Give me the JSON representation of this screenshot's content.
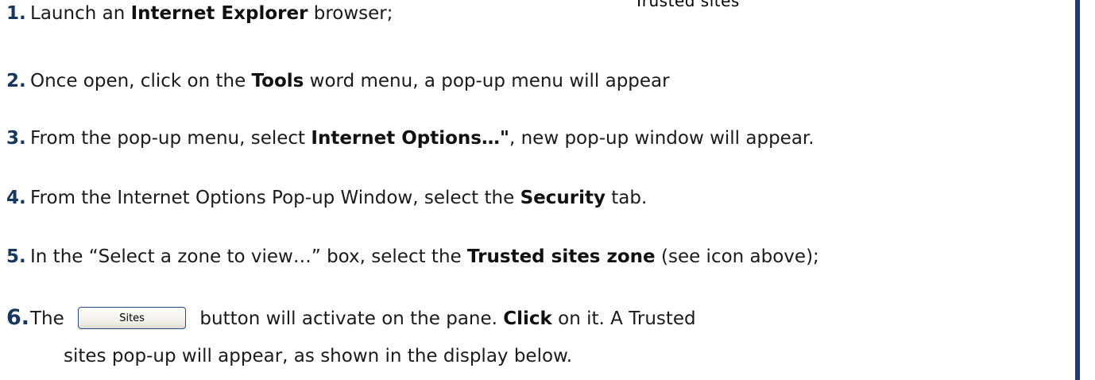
{
  "top_caption": "Trusted sites",
  "steps": [
    {
      "num": "1.",
      "pre": "Launch an ",
      "bold": "Internet Explorer",
      "post": " browser;"
    },
    {
      "num": "2.",
      "pre": "Once open, click on the ",
      "bold": "Tools",
      "post": " word menu, a pop-up menu will appear"
    },
    {
      "num": "3.",
      "pre": "From the pop-up menu, select ",
      "bold": "Internet Options…\"",
      "post": ", new pop-up window will appear."
    },
    {
      "num": "4.",
      "pre": "From the Internet Options Pop-up Window, select the ",
      "bold": "Security",
      "post": " tab."
    },
    {
      "num": "5.",
      "pre": "In the “Select a zone to view…” box, select the ",
      "bold": "Trusted sites zone",
      "post": " (see icon above);"
    },
    {
      "num": "6.",
      "pre": "The ",
      "button_label": "Sites",
      "mid": " button will activate on the pane.  ",
      "bold": "Click",
      "post": " on it.  A Trusted",
      "line2": "sites pop-up will appear, as shown in the display below."
    }
  ],
  "colors": {
    "step_number": "#17375e",
    "right_rule": "#1f3a7a",
    "button_border": "#2b4a87"
  }
}
